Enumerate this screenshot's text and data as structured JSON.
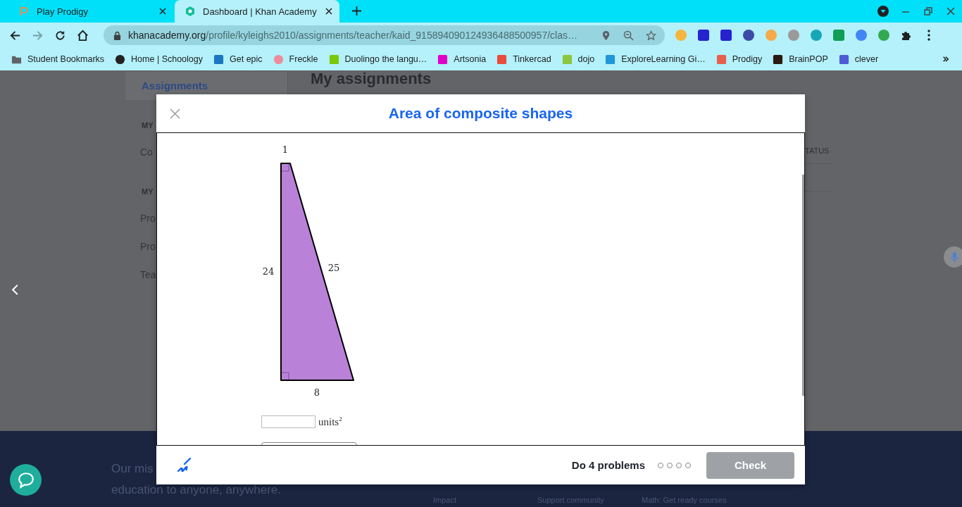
{
  "tabs": [
    {
      "title": "Play Prodigy",
      "selected": false
    },
    {
      "title": "Dashboard | Khan Academy",
      "selected": true
    }
  ],
  "address": {
    "domain": "khanacademy.org",
    "path": "/profile/kyleighs2010/assignments/teacher/kaid_915894090124936488500957/clas…"
  },
  "bookmarks": [
    "Student Bookmarks",
    "Home | Schoology",
    "Get epic",
    "Freckle",
    "Duolingo the langu…",
    "Artsonia",
    "Tinkercad",
    "dojo",
    "ExploreLearning Gi…",
    "Prodigy",
    "BrainPOP",
    "clever"
  ],
  "background_page": {
    "heading": "My assignments",
    "sidebar": [
      {
        "text": "Assignments",
        "kind": "link",
        "selected": true
      },
      {
        "text": "MY",
        "kind": "section"
      },
      {
        "text": "Co",
        "kind": "link",
        "selected": false
      },
      {
        "text": "MY",
        "kind": "section"
      },
      {
        "text": "Pro",
        "kind": "link",
        "selected": false
      },
      {
        "text": "Pro",
        "kind": "link",
        "selected": false
      },
      {
        "text": "Tea",
        "kind": "link",
        "selected": false
      }
    ],
    "table_header": "TATUS",
    "footer": {
      "mission": [
        "Our mis",
        "education to anyone, anywhere."
      ],
      "columns": [
        [
          "Impact"
        ],
        [
          "Support community"
        ],
        [
          "Math: Get ready courses"
        ]
      ]
    }
  },
  "modal": {
    "title": "Area of composite shapes",
    "figure": {
      "labels": [
        "1",
        "24",
        "25",
        "8"
      ]
    },
    "answer": {
      "unit": "units$^{2}$"
    },
    "footer": {
      "task": "Do 4 problems",
      "progress": [
        {
          "done": false
        },
        {
          "done": false
        },
        {
          "done": false
        },
        {
          "done": false
        }
      ],
      "check": {
        "label": "Check",
        "disabled": true
      }
    }
  }
}
